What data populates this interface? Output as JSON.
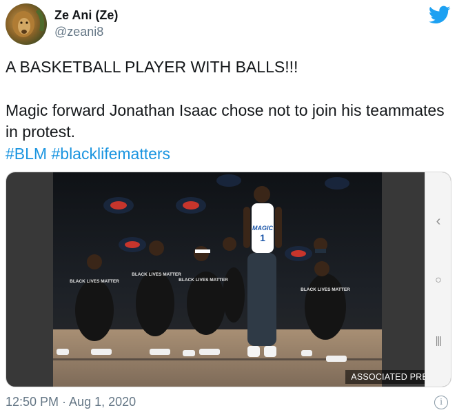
{
  "user": {
    "display_name": "Ze Ani (Ze)",
    "handle": "@zeani8",
    "avatar_icon": "lion-avatar"
  },
  "brand": {
    "icon": "twitter-bird-icon",
    "color": "#1da1f2"
  },
  "tweet": {
    "line1": "A BASKETBALL PLAYER WITH BALLS!!!",
    "line2": "Magic forward Jonathan Isaac chose not to join his teammates in protest.",
    "hashtags": [
      "#BLM",
      "#blacklifematters"
    ],
    "hashtag_color": "#1b95e0"
  },
  "media": {
    "credit": "ASSOCIATED PRESS",
    "shirt_text": "BLACK LIVES MATTER",
    "jersey_text": "MAGIC",
    "jersey_number": "1",
    "android_nav": {
      "back": "‹",
      "home": "○",
      "recent": "|||"
    }
  },
  "footer": {
    "timestamp": "12:50 PM · Aug 1, 2020",
    "info_icon": "info-icon"
  }
}
